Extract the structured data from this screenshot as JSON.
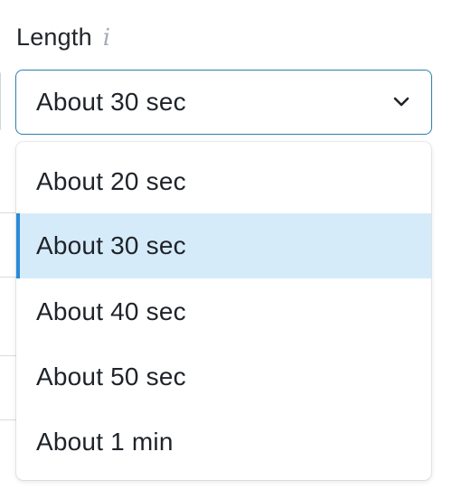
{
  "field": {
    "label": "Length",
    "info_icon": "info-icon",
    "selected_value": "About 30 sec",
    "chevron_icon": "chevron-down-icon"
  },
  "dropdown": {
    "options": [
      {
        "label": "About 20 sec",
        "selected": false
      },
      {
        "label": "About 30 sec",
        "selected": true
      },
      {
        "label": "About 40 sec",
        "selected": false
      },
      {
        "label": "About 50 sec",
        "selected": false
      },
      {
        "label": "About 1 min",
        "selected": false
      }
    ]
  },
  "colors": {
    "accent_border": "#2c7fb0",
    "selected_bg": "#d6ebfa",
    "selected_bar": "#2b8ad8"
  }
}
